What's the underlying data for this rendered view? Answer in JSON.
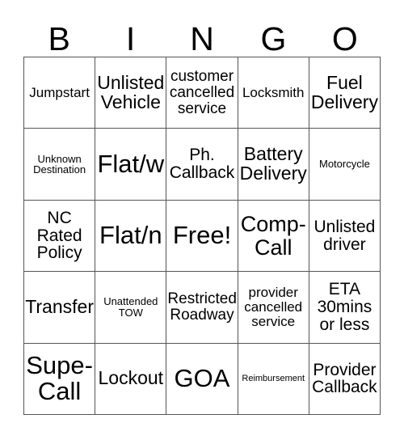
{
  "card": {
    "title_letters": [
      "B",
      "I",
      "N",
      "G",
      "O"
    ],
    "border_color": "#555555",
    "background_color": "#ffffff",
    "text_color": "#000000",
    "rows": [
      [
        {
          "text": "Jumpstart",
          "size": "lg"
        },
        {
          "text": "Unlisted\nVehicle",
          "size": "3xl"
        },
        {
          "text": "customer\ncancelled\nservice",
          "size": "xl"
        },
        {
          "text": "Locksmith",
          "size": "lg"
        },
        {
          "text": "Fuel\nDelivery",
          "size": "3xl"
        }
      ],
      [
        {
          "text": "Unknown\nDestination",
          "size": "sm"
        },
        {
          "text": "Flat/w",
          "size": "5xl"
        },
        {
          "text": "Ph.\nCallback",
          "size": "2xl"
        },
        {
          "text": "Battery\nDelivery",
          "size": "3xl"
        },
        {
          "text": "Motorcycle",
          "size": "sm"
        }
      ],
      [
        {
          "text": "NC\nRated\nPolicy",
          "size": "2xl"
        },
        {
          "text": "Flat/n",
          "size": "5xl"
        },
        {
          "text": "Free!",
          "size": "5xl"
        },
        {
          "text": "Comp-\nCall",
          "size": "4xl"
        },
        {
          "text": "Unlisted\ndriver",
          "size": "2xl"
        }
      ],
      [
        {
          "text": "Transfer",
          "size": "3xl"
        },
        {
          "text": "Unattended\nTOW",
          "size": "sm"
        },
        {
          "text": "Restricted\nRoadway",
          "size": "xl"
        },
        {
          "text": "provider\ncancelled\nservice",
          "size": "lg"
        },
        {
          "text": "ETA\n30mins\nor less",
          "size": "2xl"
        }
      ],
      [
        {
          "text": "Supe-\nCall",
          "size": "5xl"
        },
        {
          "text": "Lockout",
          "size": "3xl"
        },
        {
          "text": "GOA",
          "size": "5xl"
        },
        {
          "text": "Reimbursement",
          "size": "xs"
        },
        {
          "text": "Provider\nCallback",
          "size": "2xl"
        }
      ]
    ]
  }
}
